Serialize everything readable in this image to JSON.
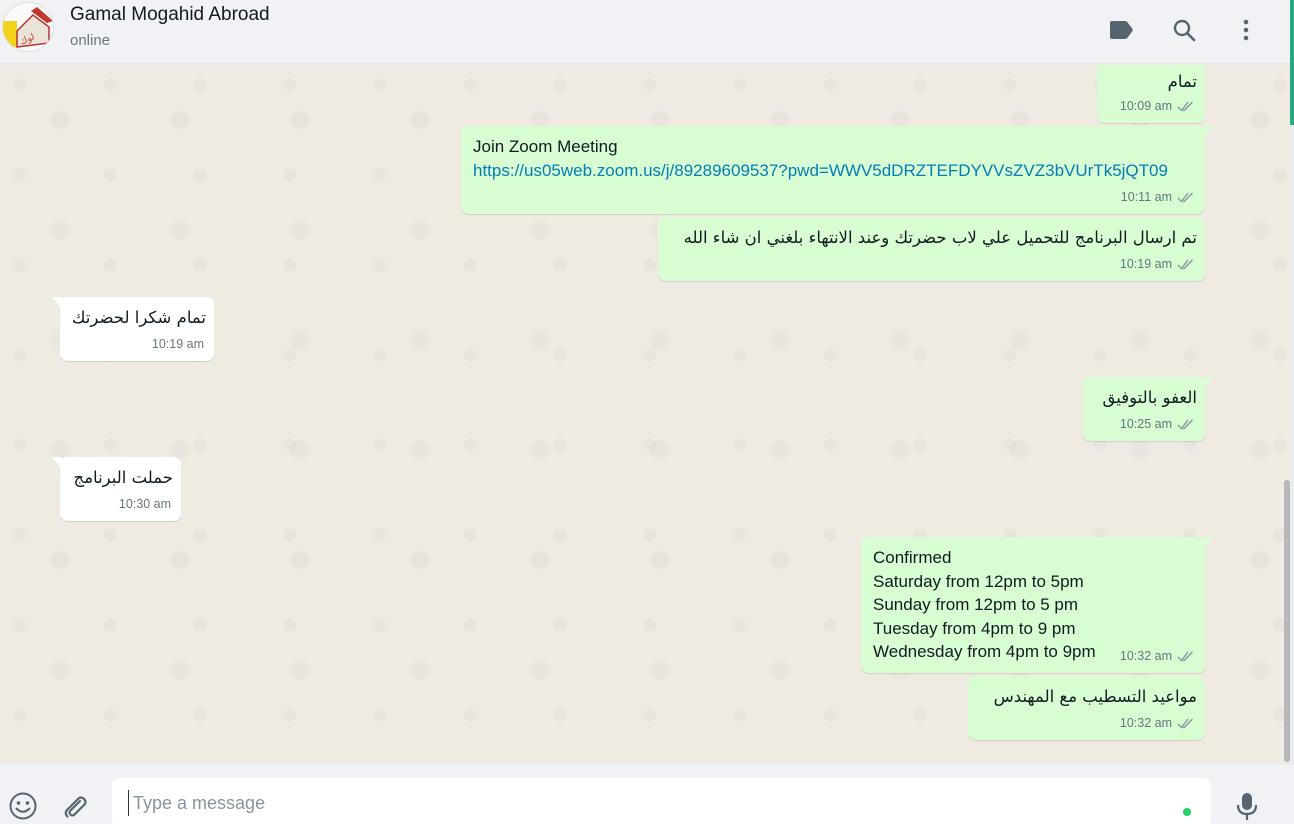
{
  "header": {
    "contact_name": "Gamal Mogahid Abroad",
    "status": "online",
    "icons": [
      "label-icon",
      "search-icon",
      "menu-icon"
    ]
  },
  "messages": [
    {
      "direction": "out",
      "text": "تمام",
      "time": "10:09 am",
      "status": "read"
    },
    {
      "direction": "out",
      "title": "Join Zoom Meeting",
      "link": "https://us05web.zoom.us/j/89289609537?pwd=WWV5dDRZTEFDYVVsZVZ3bVUrTk5jQT09",
      "time": "10:11 am",
      "status": "read"
    },
    {
      "direction": "out",
      "text": "تم ارسال البرنامج للتحميل علي لاب حضرتك وعند الانتهاء بلغني ان شاء الله",
      "time": "10:19 am",
      "status": "read"
    },
    {
      "direction": "in",
      "text": "تمام شكرا لحضرتك",
      "time": "10:19 am"
    },
    {
      "direction": "out",
      "text": "العفو بالتوفيق",
      "time": "10:25 am",
      "status": "read"
    },
    {
      "direction": "in",
      "text": "حملت البرنامج",
      "time": "10:30 am"
    },
    {
      "direction": "out",
      "lines": [
        "Confirmed",
        "Saturday from 12pm to 5pm",
        "Sunday from 12pm to 5 pm",
        "Tuesday from 4pm to 9 pm",
        "Wednesday from 4pm to 9pm"
      ],
      "time": "10:32 am",
      "status": "read"
    },
    {
      "direction": "out",
      "text": "مواعيد التسطيب مع المهندس",
      "time": "10:32 am",
      "status": "read"
    }
  ],
  "composer": {
    "placeholder": "Type a message",
    "icons": [
      "emoji-icon",
      "attach-icon",
      "microphone-icon"
    ]
  },
  "colors": {
    "outgoing_bubble": "#d9fdd3",
    "incoming_bubble": "#ffffff",
    "chat_background": "#efeae2",
    "link": "#027eb5",
    "accent": "#25d366"
  }
}
